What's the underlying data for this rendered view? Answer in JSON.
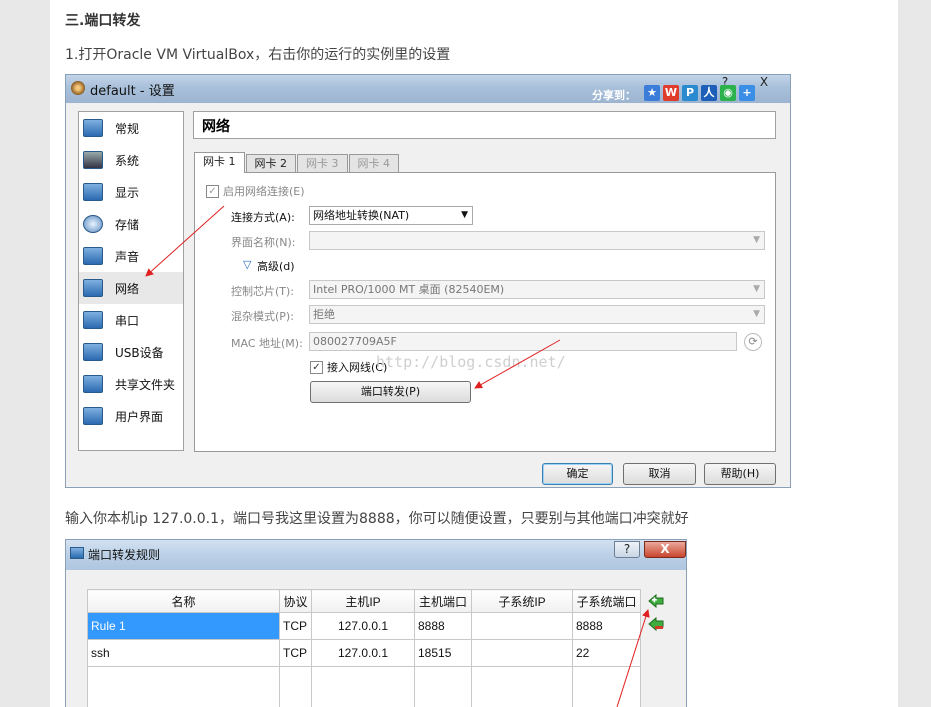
{
  "article": {
    "heading": "三.端口转发",
    "step1": "1.打开Oracle VM VirtualBox，右击你的运行的实例里的设置",
    "step2": "输入你本机ip 127.0.0.1，端口号我这里设置为8888，你可以随便设置，只要别与其他端口冲突就好"
  },
  "settings_window": {
    "title": "default - 设置",
    "share_label": "分享到：",
    "controls": {
      "help": "?",
      "close": "X"
    },
    "sidebar": [
      {
        "label": "常规",
        "icon": "monitor-icon"
      },
      {
        "label": "系统",
        "icon": "chip-icon"
      },
      {
        "label": "显示",
        "icon": "display-icon"
      },
      {
        "label": "存储",
        "icon": "disk-icon"
      },
      {
        "label": "声音",
        "icon": "speaker-icon"
      },
      {
        "label": "网络",
        "icon": "network-icon",
        "selected": true
      },
      {
        "label": "串口",
        "icon": "serial-port-icon"
      },
      {
        "label": "USB设备",
        "icon": "usb-icon"
      },
      {
        "label": "共享文件夹",
        "icon": "folder-icon"
      },
      {
        "label": "用户界面",
        "icon": "ui-icon"
      }
    ],
    "section_title": "网络",
    "tabs": [
      "网卡 1",
      "网卡 2",
      "网卡 3",
      "网卡 4"
    ],
    "enable_label": "启用网络连接(E)",
    "attach_label": "连接方式(A):",
    "attach_value": "网络地址转换(NAT)",
    "name_label": "界面名称(N):",
    "advanced_label": "高级(d)",
    "adapter_label": "控制芯片(T):",
    "adapter_value": "Intel PRO/1000 MT 桌面 (82540EM)",
    "promisc_label": "混杂模式(P):",
    "promisc_value": "拒绝",
    "mac_label": "MAC 地址(M):",
    "mac_value": "080027709A5F",
    "cable_label": "接入网线(C)",
    "port_forward_button": "端口转发(P)",
    "watermark": "http://blog.csdn.net/",
    "ok_button": "确定",
    "cancel_button": "取消",
    "help_button": "帮助(H)"
  },
  "port_window": {
    "title": "端口转发规则",
    "controls": {
      "help": "?",
      "close": "X"
    },
    "columns": [
      "名称",
      "协议",
      "主机IP",
      "主机端口",
      "子系统IP",
      "子系统端口"
    ],
    "rows": [
      [
        "Rule 1",
        "TCP",
        "127.0.0.1",
        "8888",
        "",
        "8888"
      ],
      [
        "ssh",
        "TCP",
        "127.0.0.1",
        "18515",
        "",
        "22"
      ]
    ]
  }
}
